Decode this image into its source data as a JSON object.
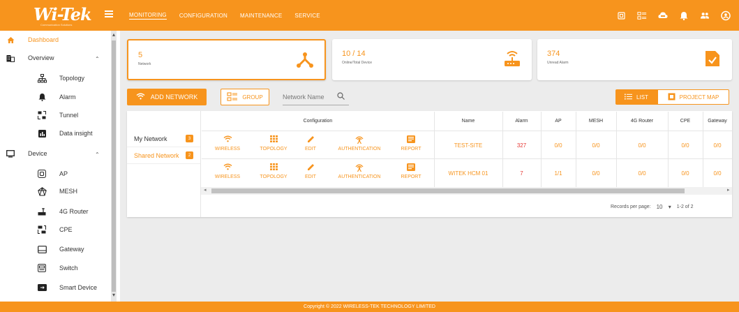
{
  "brand": {
    "logo": "Wi-Tek",
    "tagline": "Communication Solutions"
  },
  "colors": {
    "accent": "#f7941d",
    "alarm": "#e53935"
  },
  "topnav": [
    "MONITORING",
    "CONFIGURATION",
    "MAINTENANCE",
    "SERVICE"
  ],
  "top_icons": [
    "chip-icon",
    "grid-icon",
    "cloud-icon",
    "bell-icon",
    "users-icon",
    "account-icon"
  ],
  "sidebar": {
    "dashboard": "Dashboard",
    "overview": "Overview",
    "overview_items": [
      "Topology",
      "Alarm",
      "Tunnel",
      "Data insight"
    ],
    "device": "Device",
    "device_items": [
      "AP",
      "MESH",
      "4G Router",
      "CPE",
      "Gateway",
      "Switch",
      "Smart Device"
    ]
  },
  "cards": [
    {
      "value": "5",
      "label": "Network",
      "icon": "network-icon"
    },
    {
      "value": "10 / 14",
      "label": "Online/Total Device",
      "icon": "router-icon"
    },
    {
      "value": "374",
      "label": "Unread Alarm",
      "icon": "report-icon"
    }
  ],
  "toolbar": {
    "add_network": "ADD NETWORK",
    "group": "GROUP",
    "search_placeholder": "Network Name",
    "list": "LIST",
    "project_map": "PROJECT MAP"
  },
  "networks": [
    {
      "label": "My Network",
      "count": "3"
    },
    {
      "label": "Shared Network",
      "count": "2"
    }
  ],
  "table": {
    "config_header": "Configuration",
    "headers": [
      "Name",
      "Alarm",
      "AP",
      "MESH",
      "4G Router",
      "CPE",
      "Gateway"
    ],
    "actions": [
      "WIRELESS",
      "TOPOLOGY",
      "EDIT",
      "AUTHENTICATION",
      "REPORT"
    ],
    "rows": [
      {
        "name": "TEST-SITE",
        "alarm": "327",
        "ap": "0/0",
        "mesh": "0/0",
        "router": "0/0",
        "cpe": "0/0",
        "gateway": "0/0"
      },
      {
        "name": "WITEK HCM 01",
        "alarm": "7",
        "ap": "1/1",
        "mesh": "0/0",
        "router": "0/0",
        "cpe": "0/0",
        "gateway": "0/0"
      }
    ]
  },
  "pagination": {
    "label": "Records per page:",
    "per_page": "10",
    "range": "1-2 of 2"
  },
  "footer": "Copyright © 2022 WIRELESS-TEK TECHNOLOGY LIMITED"
}
